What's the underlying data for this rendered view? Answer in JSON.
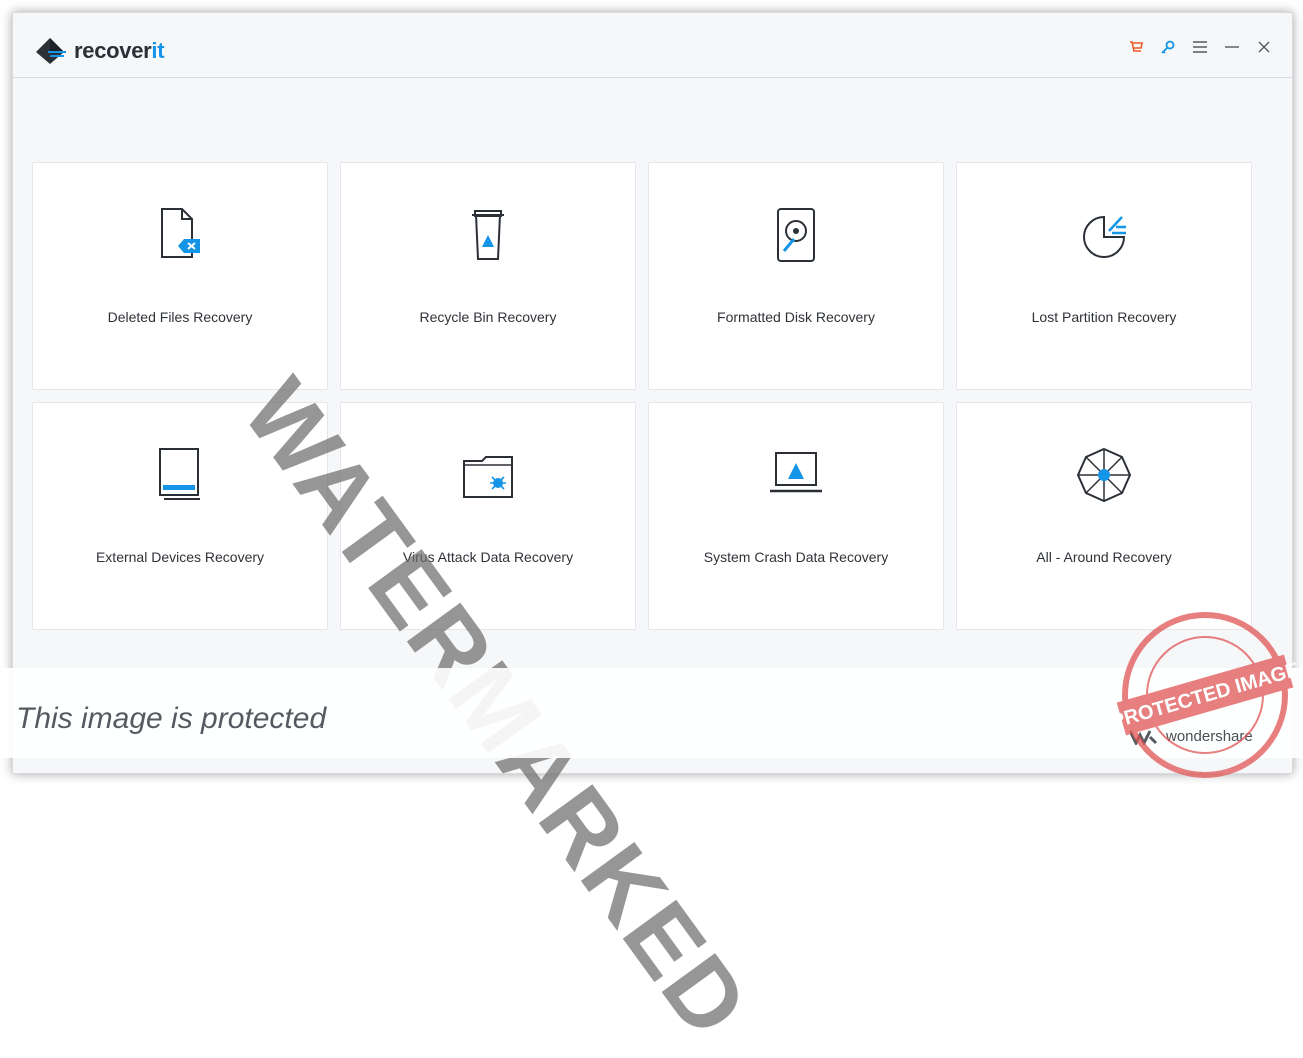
{
  "app": {
    "logo_text_main": "recover",
    "logo_text_accent": "it",
    "title_icons": [
      "cart-icon",
      "key-icon",
      "menu-icon",
      "minimize-icon",
      "close-icon"
    ]
  },
  "cards": [
    {
      "label": "Deleted Files Recovery",
      "icon": "deleted-file-icon"
    },
    {
      "label": "Recycle Bin Recovery",
      "icon": "recycle-bin-icon"
    },
    {
      "label": "Formatted Disk Recovery",
      "icon": "hard-disk-icon"
    },
    {
      "label": "Lost Partition Recovery",
      "icon": "partition-pie-icon"
    },
    {
      "label": "External Devices Recovery",
      "icon": "external-device-icon"
    },
    {
      "label": "Virus Attack Data Recovery",
      "icon": "virus-folder-icon"
    },
    {
      "label": "System Crash Data Recovery",
      "icon": "crashed-laptop-icon"
    },
    {
      "label": "All - Around Recovery",
      "icon": "all-around-wheel-icon"
    }
  ],
  "overlay": {
    "watermark": "WATERMARKED",
    "protected_text": "This image is protected",
    "brand": "wondershare",
    "stamp_text": "PROTECTED IMAGE"
  },
  "colors": {
    "accent": "#1495e8",
    "cart": "#f05a28",
    "text": "#2f3338"
  }
}
